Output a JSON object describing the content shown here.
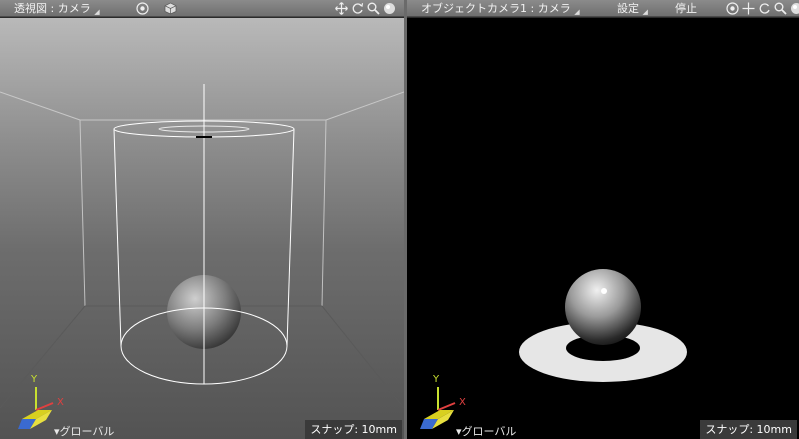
{
  "left_view": {
    "title": "透視図 : カメラ",
    "coordinate_mode": "グローバル",
    "snap_status": "スナップ: 10mm",
    "axis_y": "Y",
    "axis_x": "X"
  },
  "right_view": {
    "title": "オブジェクトカメラ1 : カメラ",
    "settings_label": "設定",
    "stop_label": "停止",
    "coordinate_mode": "グローバル",
    "snap_status": "スナップ: 10mm",
    "axis_y": "Y",
    "axis_x": "X"
  },
  "icons": [
    "target-icon",
    "cube-icon",
    "move-icon",
    "rotate-icon",
    "zoom-icon",
    "display-icon"
  ],
  "colors": {
    "titlebar": "#7f7f7f",
    "axis_y": "#c8e030",
    "axis_x": "#e04040",
    "axis_z": "#3a6ad0",
    "render_bg": "#000000"
  }
}
